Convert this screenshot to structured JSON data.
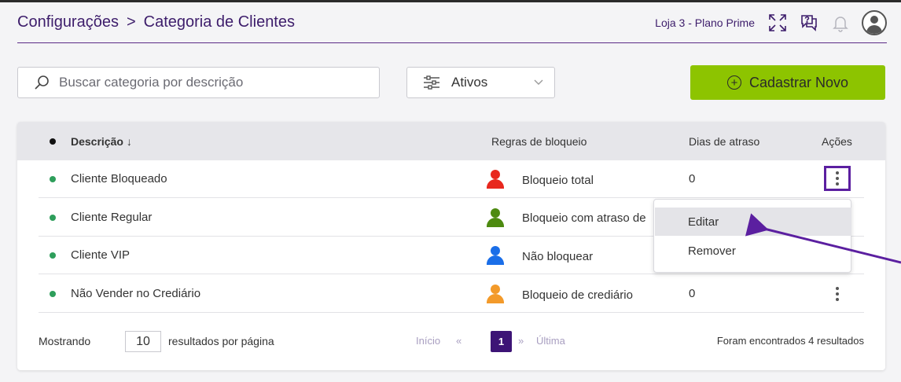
{
  "header": {
    "breadcrumb": [
      "Configurações",
      "Categoria de Clientes"
    ],
    "separator": ">",
    "store_label": "Loja 3 - Plano Prime",
    "icons": [
      "fullscreen-icon",
      "help-icon",
      "bell-icon",
      "user-avatar-icon"
    ]
  },
  "toolbar": {
    "search_placeholder": "Buscar categoria por descrição",
    "filter_value": "Ativos",
    "new_button_label": "Cadastrar Novo"
  },
  "table": {
    "columns": [
      "Descrição",
      "Regras de bloqueio",
      "Dias de atraso",
      "Ações"
    ],
    "sort_indicator": "↓",
    "rows": [
      {
        "descricao": "Cliente Bloqueado",
        "regra": "Bloqueio total",
        "regra_color": "#e8281e",
        "dias": "0"
      },
      {
        "descricao": "Cliente Regular",
        "regra": "Bloqueio com atraso de",
        "regra_color": "#4d8a10",
        "dias": ""
      },
      {
        "descricao": "Cliente VIP",
        "regra": "Não bloquear",
        "regra_color": "#1a6ee8",
        "dias": ""
      },
      {
        "descricao": "Não Vender no Crediário",
        "regra": "Bloqueio de crediário",
        "regra_color": "#f39a2a",
        "dias": "0"
      }
    ]
  },
  "action_menu": {
    "items": [
      "Editar",
      "Remover"
    ]
  },
  "pagination": {
    "showing_label": "Mostrando",
    "per_page": "10",
    "per_page_suffix": "resultados por página",
    "first": "Início",
    "prev": "«",
    "current": "1",
    "next": "»",
    "last": "Última",
    "results_text": "Foram encontrados 4 resultados"
  },
  "colors": {
    "brand_purple": "#3d1d6b",
    "accent_green": "#8dc400",
    "status_dot": "#2e9e5b",
    "arrow": "#5b1fa0"
  }
}
